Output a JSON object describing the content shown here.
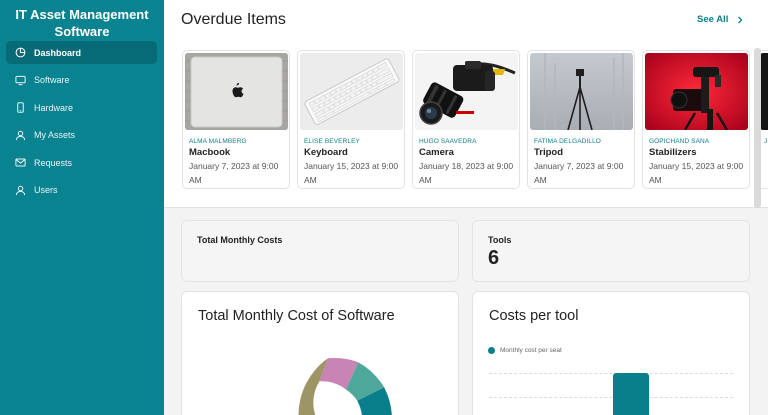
{
  "app": {
    "title": "IT Asset Management Software"
  },
  "sidebar": {
    "items": [
      {
        "label": "Dashboard",
        "icon": "dashboard-icon",
        "active": true
      },
      {
        "label": "Software",
        "icon": "monitor-icon",
        "active": false
      },
      {
        "label": "Hardware",
        "icon": "phone-icon",
        "active": false
      },
      {
        "label": "My Assets",
        "icon": "user-icon",
        "active": false
      },
      {
        "label": "Requests",
        "icon": "mail-icon",
        "active": false
      },
      {
        "label": "Users",
        "icon": "users-icon",
        "active": false
      }
    ]
  },
  "overdue": {
    "title": "Overdue Items",
    "see_all_label": "See All",
    "items": [
      {
        "user": "ALMA MALMBERG",
        "item": "Macbook",
        "date": "January 7, 2023 at 9:00 AM",
        "image": "laptop"
      },
      {
        "user": "ELISE BEVERLEY",
        "item": "Keyboard",
        "date": "January 15, 2023 at 9:00 AM",
        "image": "keyboard"
      },
      {
        "user": "HUGO SAAVEDRA",
        "item": "Camera",
        "date": "January 18, 2023 at 9:00 AM",
        "image": "camera"
      },
      {
        "user": "FATIMA DELGADILLO",
        "item": "Tripod",
        "date": "January 7, 2023 at 9:00 AM",
        "image": "tripod"
      },
      {
        "user": "GOPICHAND SANA",
        "item": "Stabilizers",
        "date": "January 15, 2023 at 9:00 AM",
        "image": "stabilizer"
      },
      {
        "user": "J",
        "item": "",
        "date": "",
        "image": "partial"
      }
    ]
  },
  "stats": {
    "total_monthly_costs_label": "Total Monthly Costs",
    "tools_label": "Tools",
    "tools_value": "6"
  },
  "software_cost": {
    "title": "Total Monthly Cost of Software"
  },
  "costs_per_tool": {
    "title": "Costs per tool",
    "legend_label": "Monthly cost per seat"
  },
  "colors": {
    "brand": "#0a8390",
    "brand_dark": "#066b76",
    "accent_text": "#0a7f8c",
    "donut": [
      "#9e9566",
      "#c784b4",
      "#4fa89c",
      "#0a7f8c"
    ]
  }
}
